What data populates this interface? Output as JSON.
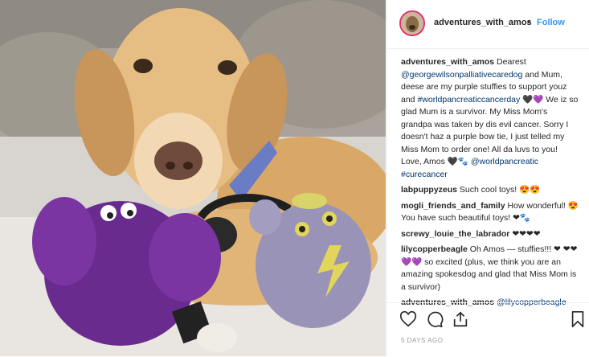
{
  "post": {
    "username": "adventures_with_amos",
    "dot": "•",
    "follow_label": "Follow",
    "caption": {
      "username": "adventures_with_amos",
      "t1": " Dearest ",
      "mention1": "@georgewilsonpalliativecaredog",
      "t2": " and Mum, deese are my purple stuffies to support youz and ",
      "hashtag1": "#worldpancreaticcancerday",
      "t3": " 🖤💜 We iz so glad Mum is a survivor. My Miss Mom's grandpa was taken by dis evil cancer. Sorry I doesn't haz a purple bow tie, I just telled my Miss Mom to order one! All da luvs to you! Love, Amos 🖤🐾 ",
      "mention2": "@worldpancreatic",
      "t4": " ",
      "hashtag2": "#curecancer"
    },
    "comments": [
      {
        "user": "labpuppyzeus",
        "pre": " Such cool toys! 😍😍",
        "mention": "",
        "post": ""
      },
      {
        "user": "mogli_friends_and_family",
        "pre": " How wonderful! 😍You have such beautiful toys! ❤🐾",
        "mention": "",
        "post": ""
      },
      {
        "user": "screwy_louie_the_labrador",
        "pre": " ❤❤❤❤",
        "mention": "",
        "post": ""
      },
      {
        "user": "lilycopperbeagle",
        "pre": " Oh Amos — stuffies!!! ❤ ❤❤💜💜 so excited (plus, we think you are an amazing spokesdog and glad that Miss Mom is a survivor)",
        "mention": "",
        "post": ""
      },
      {
        "user": "adventures_with_amos",
        "pre": " ",
        "mention": "@lilycopperbeagle",
        "post": ""
      }
    ],
    "date": "5 DAYS AGO"
  },
  "icons": {
    "like": "heart-icon",
    "comment": "comment-bubble-icon",
    "share": "share-icon",
    "save": "bookmark-icon"
  }
}
